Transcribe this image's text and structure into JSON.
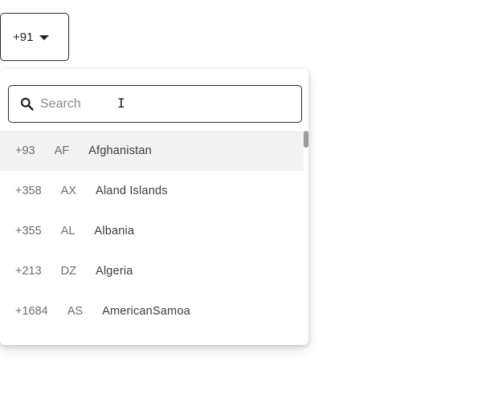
{
  "selector": {
    "value": "+91"
  },
  "search": {
    "placeholder": "Search"
  },
  "countries": [
    {
      "code": "+93",
      "iso": "AF",
      "name": "Afghanistan"
    },
    {
      "code": "+358",
      "iso": "AX",
      "name": "Aland Islands"
    },
    {
      "code": "+355",
      "iso": "AL",
      "name": "Albania"
    },
    {
      "code": "+213",
      "iso": "DZ",
      "name": "Algeria"
    },
    {
      "code": "+1684",
      "iso": "AS",
      "name": "AmericanSamoa"
    }
  ],
  "highlighted_index": 0,
  "icons": {
    "search": "search-icon",
    "caret": "caret-down-icon"
  }
}
